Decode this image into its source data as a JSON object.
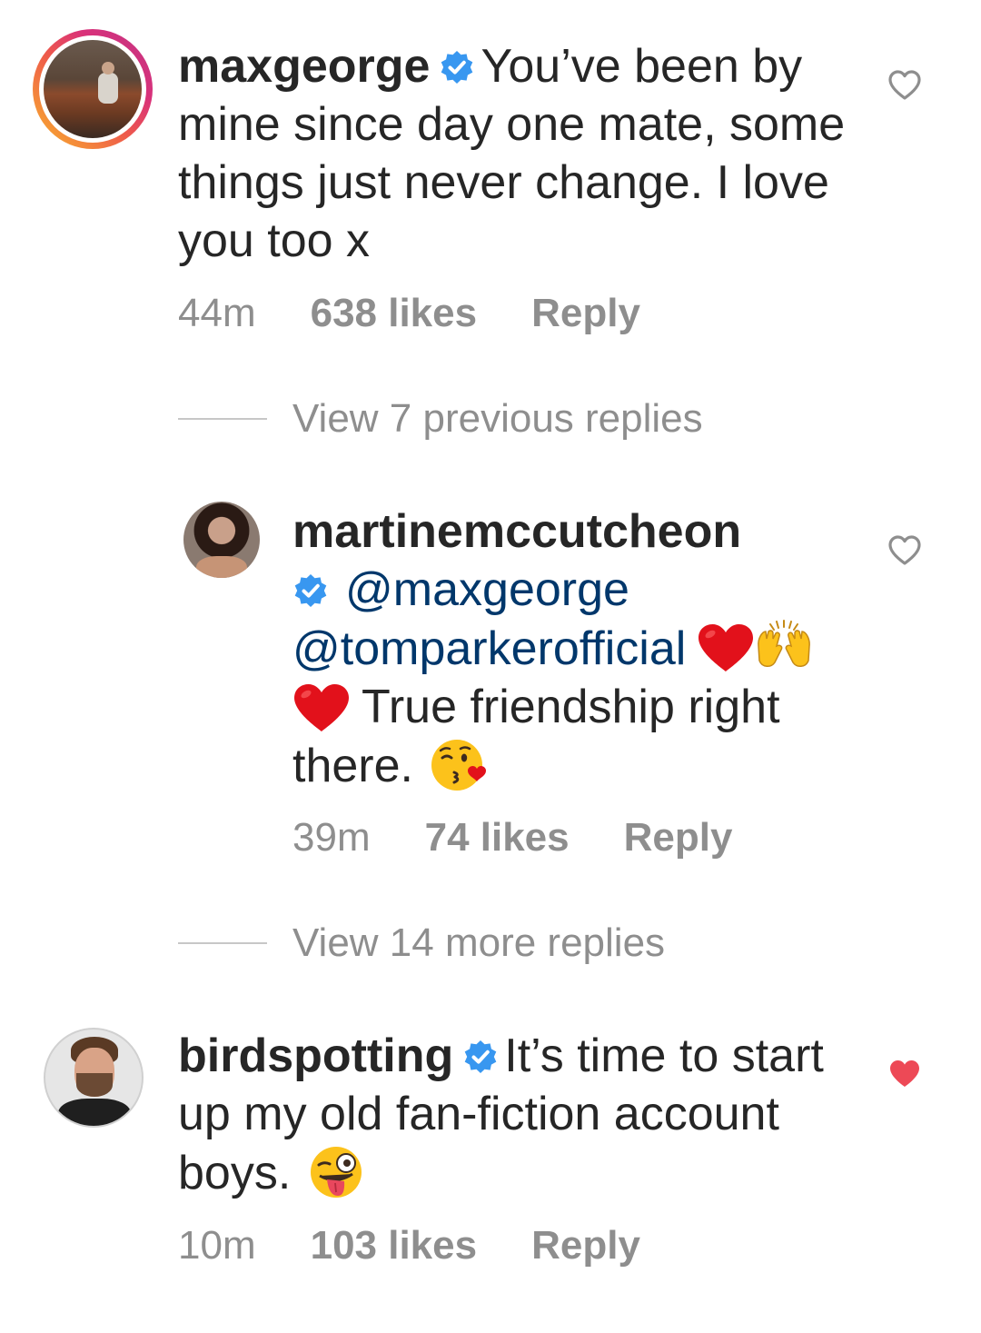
{
  "comments": [
    {
      "username": "maxgeorge",
      "verified": true,
      "text": "You’ve been by mine since day one mate, some things just never change. I love you too x",
      "time": "44m",
      "likes": "638 likes",
      "reply_label": "Reply",
      "liked": false
    },
    {
      "username": "martinemccutcheon",
      "verified": true,
      "mention1": "@maxgeorge",
      "mention2": "@tomparkerofficial",
      "text": "True friendship right there.",
      "time": "39m",
      "likes": "74 likes",
      "reply_label": "Reply",
      "liked": false
    },
    {
      "username": "birdspotting",
      "verified": true,
      "text": "It’s time to start up my old fan-fiction account boys.",
      "time": "10m",
      "likes": "103 likes",
      "reply_label": "Reply",
      "liked": true
    }
  ],
  "view_previous": "View 7 previous replies",
  "view_more": "View 14 more replies",
  "colors": {
    "text": "#262626",
    "meta": "#8e8e8e",
    "verified": "#3897f0",
    "mention": "#00376b",
    "liked_heart": "#ed4956"
  },
  "icons": [
    "heart-outline-icon",
    "heart-filled-icon",
    "verified-badge-icon",
    "red-heart-emoji",
    "raising-hands-emoji",
    "kissing-face-emoji",
    "winking-tongue-emoji"
  ]
}
